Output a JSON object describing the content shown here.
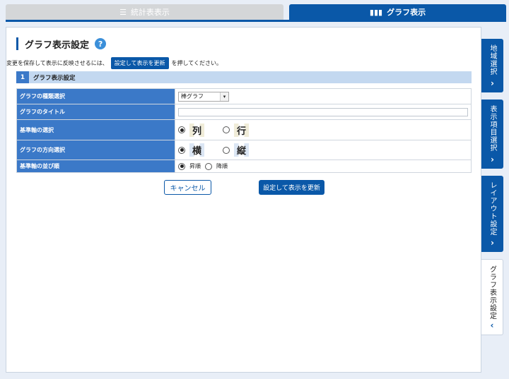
{
  "tabs": {
    "stats": {
      "label": "統計表表示",
      "icon": "list-icon"
    },
    "graph": {
      "label": "グラフ表示",
      "icon": "bar-chart-icon"
    }
  },
  "panel": {
    "title": "グラフ表示設定",
    "help": "?",
    "note_before": "変更を保存して表示に反映させるには、",
    "note_button": "設定して表示を更新",
    "note_after": "を押してください。",
    "section_number": "1",
    "section_title": "グラフ表示設定"
  },
  "form": {
    "type_label": "グラフの種類選択",
    "type_value": "棒グラフ",
    "title_label": "グラフのタイトル",
    "title_value": "",
    "axis_label": "基準軸の選択",
    "axis_opt1": "列",
    "axis_opt2": "行",
    "axis_selected": "列",
    "dir_label": "グラフの方向選択",
    "dir_opt1": "横",
    "dir_opt2": "縦",
    "dir_selected": "横",
    "order_label": "基準軸の並び順",
    "order_opt1": "昇順",
    "order_opt2": "降順",
    "order_selected": "昇順"
  },
  "buttons": {
    "cancel": "キャンセル",
    "apply": "設定して表示を更新"
  },
  "side_tabs": [
    {
      "label": "地域選択",
      "arrow": "›"
    },
    {
      "label": "表示項目選択",
      "arrow": "›"
    },
    {
      "label": "レイアウト設定",
      "arrow": "›"
    },
    {
      "label": "グラフ表示設定",
      "arrow": "‹"
    }
  ],
  "colors": {
    "primary": "#0a58a8",
    "label_bg": "#3b79c8",
    "section_bg": "#c3d8f0"
  }
}
